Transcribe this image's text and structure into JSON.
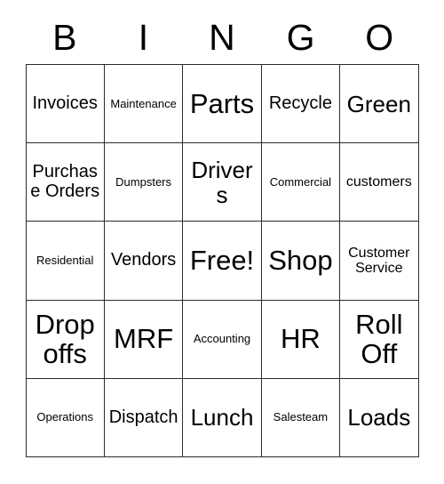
{
  "card": {
    "title": "BINGO Card",
    "header_letters": [
      "B",
      "I",
      "N",
      "G",
      "O"
    ],
    "colors": {
      "background": "#ffffff",
      "text": "#000000",
      "grid_line": "#2b2b2b"
    },
    "grid_size": "5x5",
    "free_space": "Free!",
    "rows": [
      [
        {
          "label": "Invoices",
          "size": "md"
        },
        {
          "label": "Maintenance",
          "size": "xs"
        },
        {
          "label": "Parts",
          "size": "xl"
        },
        {
          "label": "Recycle",
          "size": "md"
        },
        {
          "label": "Green",
          "size": "lg"
        }
      ],
      [
        {
          "label": "Purchase Orders",
          "size": "md"
        },
        {
          "label": "Dumpsters",
          "size": "xs"
        },
        {
          "label": "Drivers",
          "size": "lg"
        },
        {
          "label": "Commercial",
          "size": "xs"
        },
        {
          "label": "customers",
          "size": "sm"
        }
      ],
      [
        {
          "label": "Residential",
          "size": "xs"
        },
        {
          "label": "Vendors",
          "size": "md"
        },
        {
          "label": "Free!",
          "size": "xl"
        },
        {
          "label": "Shop",
          "size": "xl"
        },
        {
          "label": "Customer Service",
          "size": "sm"
        }
      ],
      [
        {
          "label": "Drop offs",
          "size": "xl"
        },
        {
          "label": "MRF",
          "size": "xl"
        },
        {
          "label": "Accounting",
          "size": "xs"
        },
        {
          "label": "HR",
          "size": "xl"
        },
        {
          "label": "Roll Off",
          "size": "xl"
        }
      ],
      [
        {
          "label": "Operations",
          "size": "xs"
        },
        {
          "label": "Dispatch",
          "size": "md"
        },
        {
          "label": "Lunch",
          "size": "lg"
        },
        {
          "label": "Salesteam",
          "size": "xs"
        },
        {
          "label": "Loads",
          "size": "lg"
        }
      ]
    ]
  }
}
